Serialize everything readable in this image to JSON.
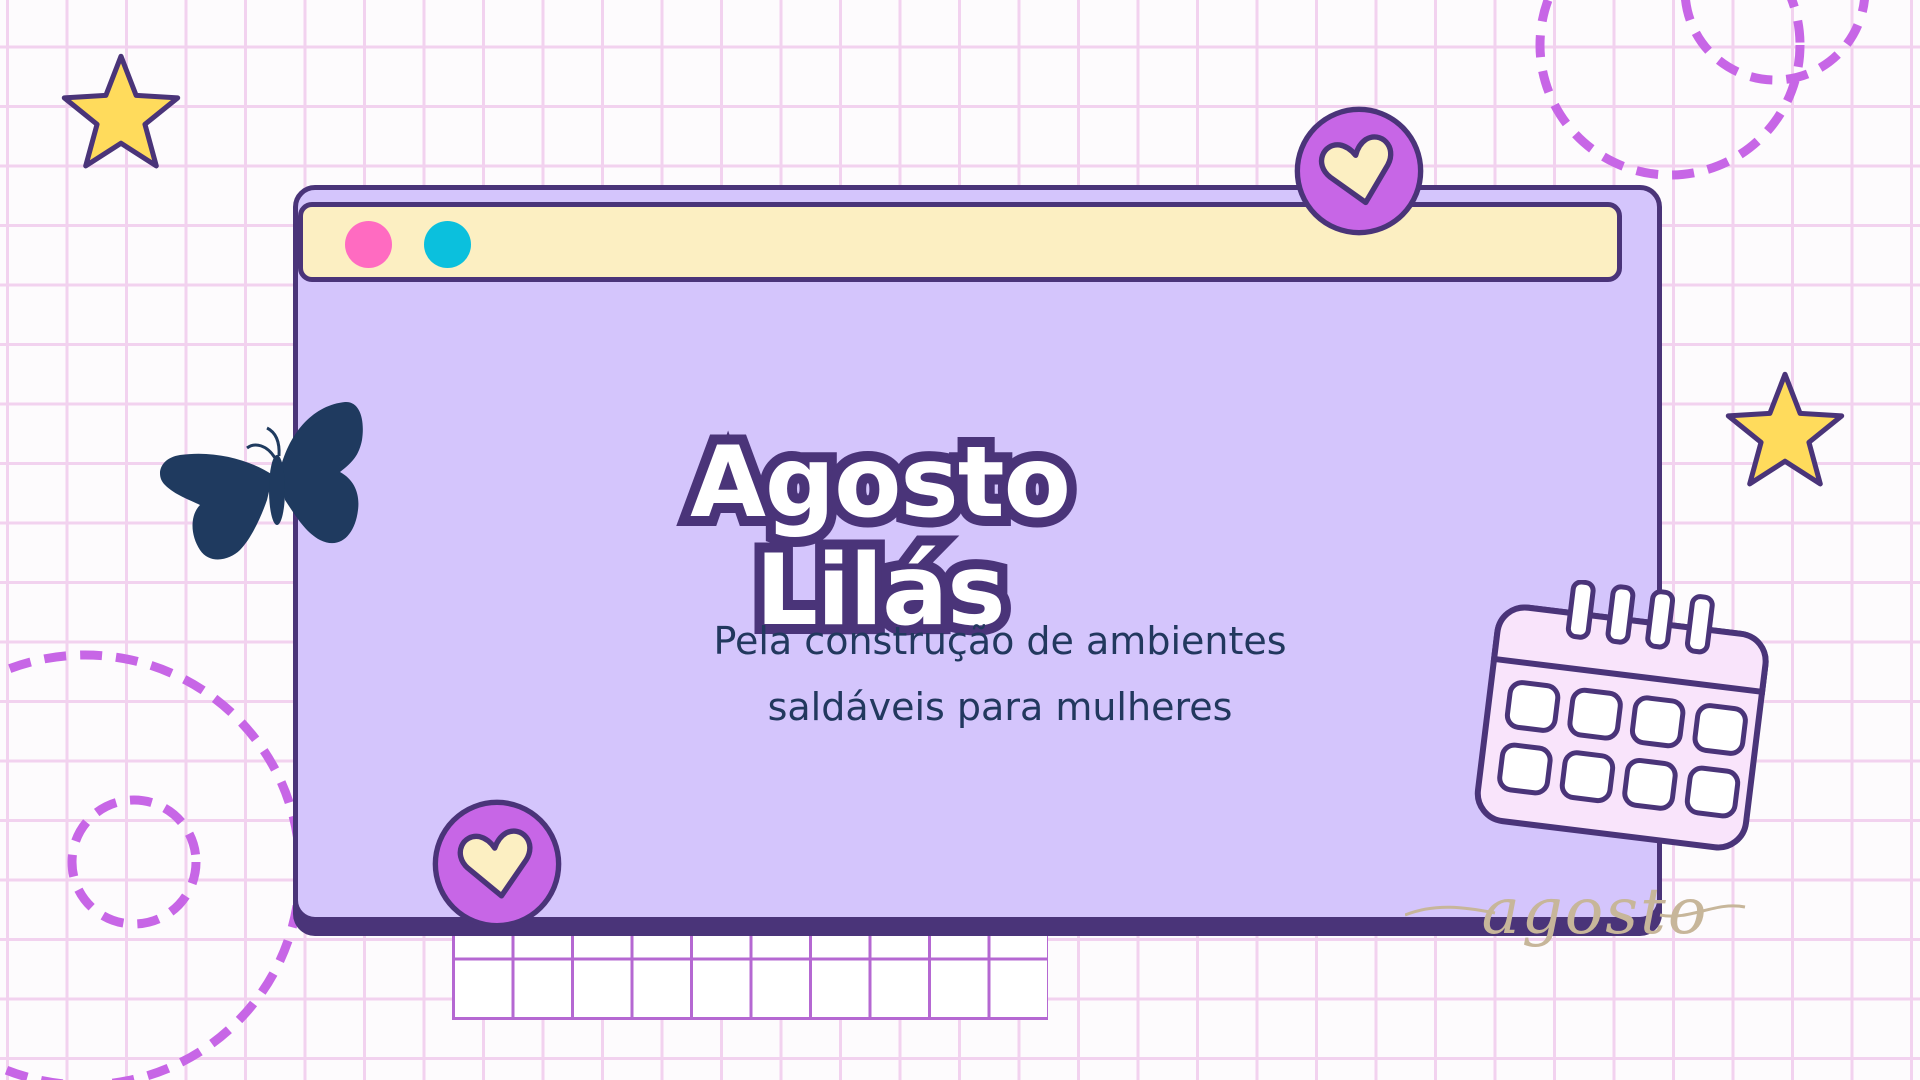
{
  "slide": {
    "title": "Agosto Lilás",
    "subtitle_line1": "Pela construção de ambientes",
    "subtitle_line2": "saldáveis para mulheres",
    "signature": "agosto"
  },
  "colors": {
    "background": "#fdfbfd",
    "grid_line": "#f2d2ef",
    "window_fill": "#d4c5fc",
    "outline": "#4a3479",
    "titlebar_fill": "#fcefc2",
    "dot_pink": "#ff6bc1",
    "dot_cyan": "#0bc0dd",
    "heart_badge": "#c766e6",
    "heart": "#fcefc2",
    "star": "#ffdb5c",
    "butterfly": "#1f3a5f",
    "dashed_circle": "#c766e6",
    "calendar_fill": "#f9e4fb",
    "title_fill": "#ffffff",
    "subtitle_text": "#22385e",
    "signature_text": "#c7b69a"
  },
  "decorations": {
    "icons": [
      "star-icon",
      "star-icon",
      "heart-icon",
      "heart-icon",
      "butterfly-icon",
      "calendar-icon",
      "dashed-circle",
      "dashed-circle",
      "dashed-circle",
      "dashed-circle"
    ]
  }
}
